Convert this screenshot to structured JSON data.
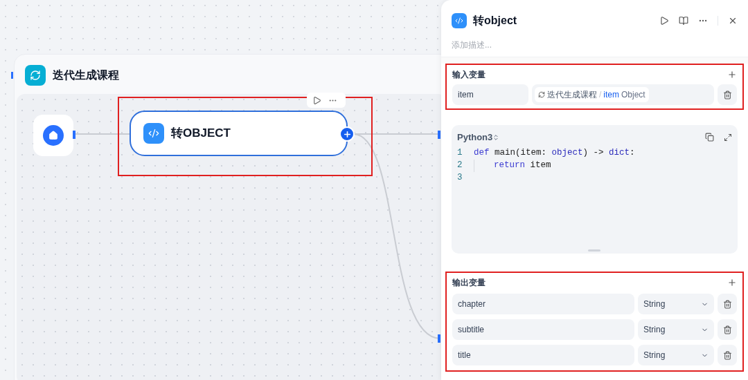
{
  "canvas": {
    "iteration": {
      "title": "迭代生成课程"
    },
    "code_node": {
      "title": "转OBJECT",
      "selected": true
    }
  },
  "panel": {
    "title": "转object",
    "description_placeholder": "添加描述...",
    "input_section": {
      "title": "输入变量",
      "variables": [
        {
          "name": "item",
          "source_node": "迭代生成课程",
          "source_separator": "/",
          "source_variable": "item",
          "source_type": "Object"
        }
      ]
    },
    "code": {
      "language": "Python3",
      "lines": [
        {
          "number": "1",
          "tokens": [
            {
              "text": "def",
              "kind": "keyword"
            },
            {
              "text": " main(item: ",
              "kind": "plain"
            },
            {
              "text": "object",
              "kind": "type"
            },
            {
              "text": ") -> ",
              "kind": "plain"
            },
            {
              "text": "dict",
              "kind": "type"
            },
            {
              "text": ":",
              "kind": "plain"
            }
          ]
        },
        {
          "number": "2",
          "indent": true,
          "tokens": [
            {
              "text": "return",
              "kind": "keyword"
            },
            {
              "text": " item",
              "kind": "plain"
            }
          ]
        },
        {
          "number": "3"
        }
      ]
    },
    "output_section": {
      "title": "输出变量",
      "variables": [
        {
          "name": "chapter",
          "type": "String"
        },
        {
          "name": "subtitle",
          "type": "String"
        },
        {
          "name": "title",
          "type": "String"
        }
      ]
    }
  }
}
